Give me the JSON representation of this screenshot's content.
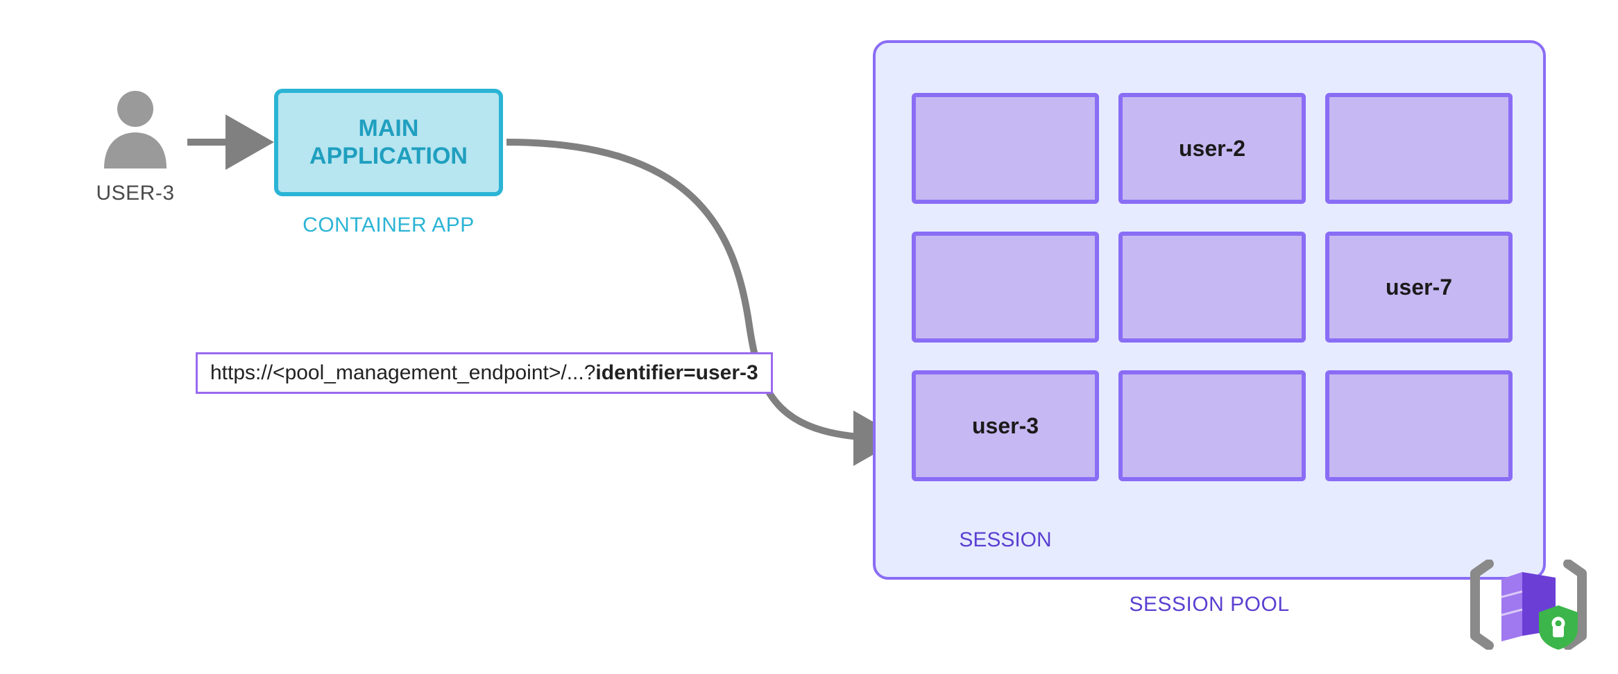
{
  "user": {
    "label": "USER-3"
  },
  "app": {
    "title_line1": "MAIN",
    "title_line2": "APPLICATION",
    "caption": "CONTAINER APP"
  },
  "url": {
    "prefix": "https://<pool_management_endpoint>/...?",
    "bold": "identifier=user-3"
  },
  "pool": {
    "caption": "SESSION POOL",
    "session_caption": "SESSION",
    "sessions": [
      {
        "label": ""
      },
      {
        "label": "user-2"
      },
      {
        "label": ""
      },
      {
        "label": ""
      },
      {
        "label": ""
      },
      {
        "label": "user-7"
      },
      {
        "label": "user-3"
      },
      {
        "label": ""
      },
      {
        "label": ""
      }
    ]
  },
  "colors": {
    "app_border": "#2bb4d5",
    "app_fill": "#b7e5f0",
    "pool_border": "#8a6df5",
    "pool_fill": "#e6ebff",
    "session_fill": "#c6b8f2",
    "arrow": "#808080"
  }
}
